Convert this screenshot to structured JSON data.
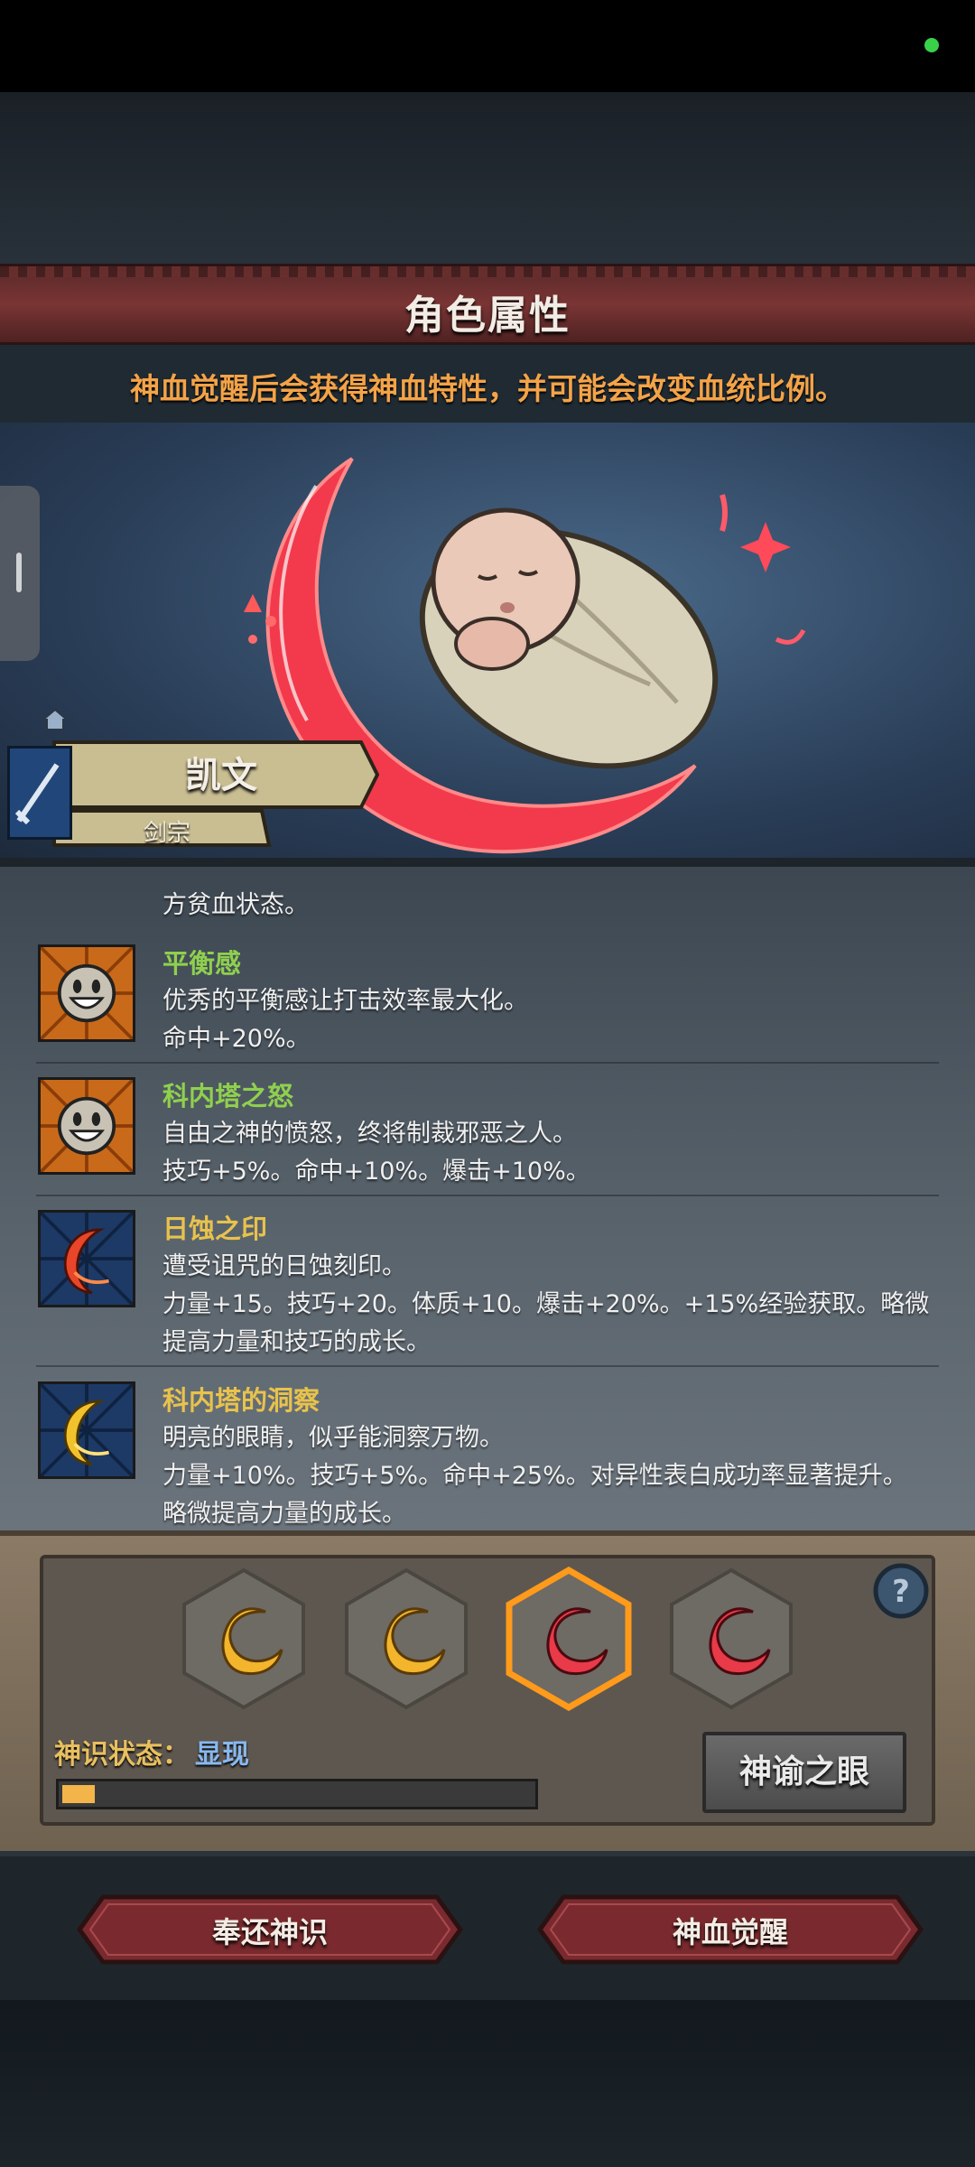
{
  "header": {
    "title": "角色属性",
    "subtitle": "神血觉醒后会获得神血特性，并可能会改变血统比例。"
  },
  "character": {
    "name": "凯文",
    "class": "剑宗"
  },
  "traits": [
    {
      "name": "",
      "name_color": "#8fcf5a",
      "icon": "partial-trait-icon",
      "lines": [
        "方贫血状态。"
      ]
    },
    {
      "name": "平衡感",
      "name_color": "#8fd04e",
      "icon": "smiley-face-icon",
      "lines": [
        "优秀的平衡感让打击效率最大化。",
        "命中+20%。"
      ]
    },
    {
      "name": "科内塔之怒",
      "name_color": "#8fd04e",
      "icon": "smiley-face-icon",
      "lines": [
        "自由之神的愤怒，终将制裁邪恶之人。",
        "技巧+5%。命中+10%。爆击+10%。"
      ]
    },
    {
      "name": "日蚀之印",
      "name_color": "#e8c24c",
      "icon": "red-crescent-icon",
      "lines": [
        "遭受诅咒的日蚀刻印。",
        "力量+15。技巧+20。体质+10。爆击+20%。+15%经验获取。略微",
        "提高力量和技巧的成长。"
      ]
    },
    {
      "name": "科内塔的洞察",
      "name_color": "#e8c24c",
      "icon": "yellow-crescent-icon",
      "lines": [
        "明亮的眼睛，似乎能洞察万物。",
        "力量+10%。技巧+5%。命中+25%。对异性表白成功率显著提升。",
        "略微提高力量的成长。"
      ]
    }
  ],
  "awakening": {
    "slots": [
      {
        "icon": "gold-crescent-icon",
        "color": "#f2b52c",
        "selected": false
      },
      {
        "icon": "gold-crescent-icon",
        "color": "#f2b52c",
        "selected": false
      },
      {
        "icon": "red-crescent-icon",
        "color": "#e83a48",
        "selected": true
      },
      {
        "icon": "red-crescent-icon",
        "color": "#e83a48",
        "selected": false
      }
    ],
    "status_label": "神识状态：",
    "status_value": "显现",
    "progress": 0.07,
    "oracle_button": "神谕之眼"
  },
  "buttons": {
    "return": "奉还神识",
    "awaken": "神血觉醒"
  },
  "colors": {
    "accent_orange": "#f3a348",
    "banner_red": "#7a3434",
    "progress_fill": "#f3b54a"
  }
}
